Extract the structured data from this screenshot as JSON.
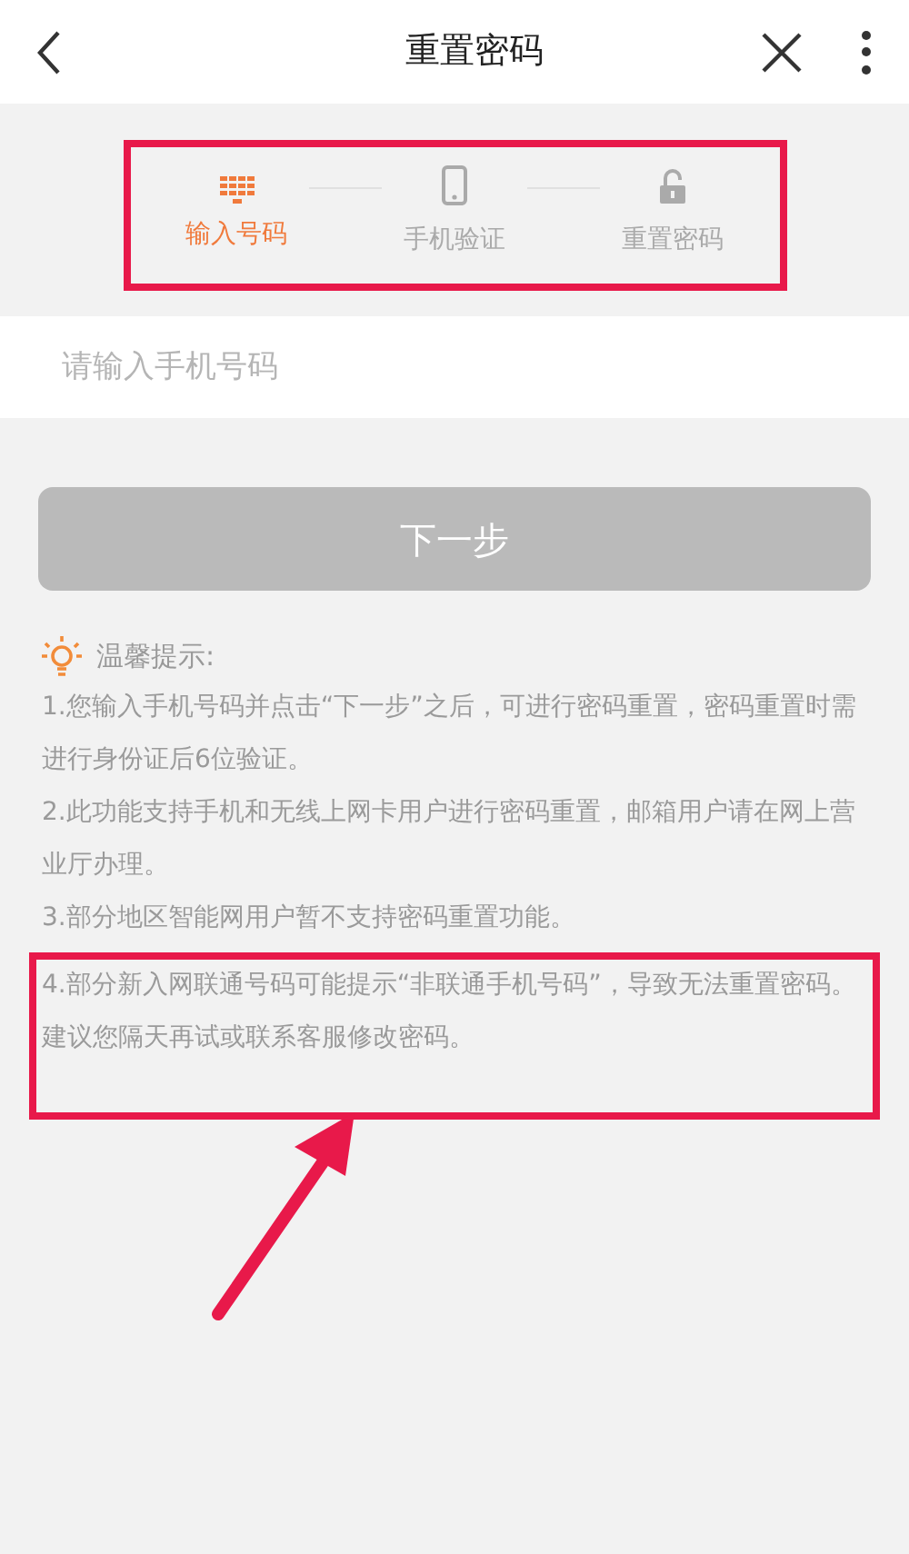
{
  "header": {
    "title": "重置密码"
  },
  "steps": {
    "highlighted": true,
    "items": [
      {
        "label": "输入号码",
        "kind": "keypad",
        "selected": true
      },
      {
        "label": "手机验证",
        "kind": "phone",
        "selected": false
      },
      {
        "label": "重置密码",
        "kind": "lock",
        "selected": false
      }
    ]
  },
  "phone_field": {
    "placeholder": "请输入手机号码"
  },
  "next_button": {
    "label": "下一步",
    "disabled": true
  },
  "tips": {
    "title": "温馨提示:",
    "items": [
      {
        "text": "1.您输入手机号码并点击“下一步”之后，可进行密码重置，密码重置时需进行身份证后6位验证。",
        "highlighted": false
      },
      {
        "text": "2.此功能支持手机和无线上网卡用户进行密码重置，邮箱用户请在网上营业厅办理。",
        "highlighted": false
      },
      {
        "text": "3.部分地区智能网用户暂不支持密码重置功能。",
        "highlighted": false
      },
      {
        "text": "4.部分新入网联通号码可能提示“非联通手机号码”，导致无法重置密码。建议您隔天再试或联系客服修改密码。",
        "highlighted": true
      }
    ]
  },
  "annotation_arrow": true
}
